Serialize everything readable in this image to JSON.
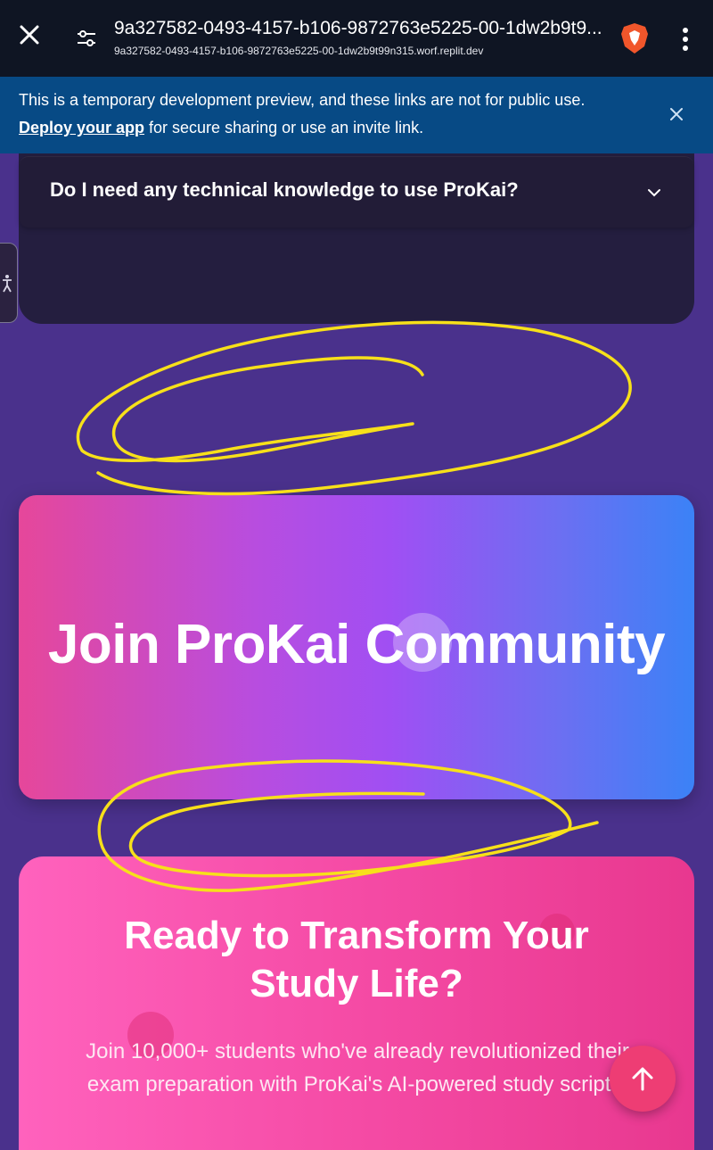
{
  "browser": {
    "title": "9a327582-0493-4157-b106-9872763e5225-00-1dw2b9t9...",
    "url": "9a327582-0493-4157-b106-9872763e5225-00-1dw2b9t99n315.worf.replit.dev",
    "icons": [
      "close-icon",
      "tune-icon",
      "brave-icon",
      "more-vertical-icon"
    ]
  },
  "banner": {
    "message": "This is a temporary development preview, and these links are not for public use.",
    "link_label": "Deploy your app",
    "suffix": " for secure sharing or use an invite link."
  },
  "faq": {
    "question": "Do I need any technical knowledge to use ProKai?"
  },
  "community": {
    "heading": "Join ProKai Community"
  },
  "cta": {
    "heading_line1": "Ready to Transform Your",
    "heading_line2": "Study Life?",
    "text": "Join 10,000+ students who've already revolutionized their exam preparation with ProKai's AI-powered study scripts."
  },
  "colors": {
    "page_bg": "#4a318c",
    "banner_bg": "#074a85",
    "scribble": "#f7e01a",
    "scroll_top": "#ee3d74"
  }
}
